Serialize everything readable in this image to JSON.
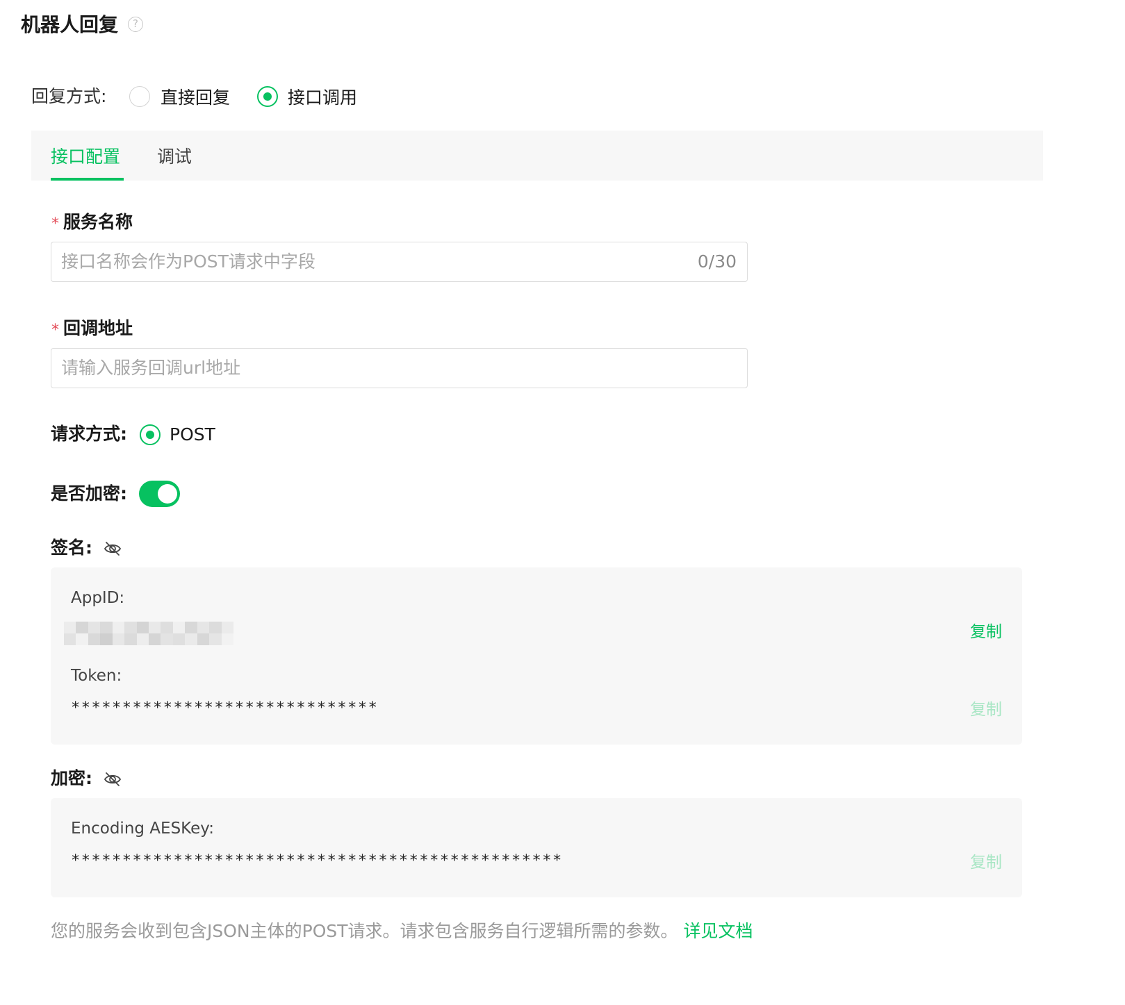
{
  "header": {
    "title": "机器人回复",
    "help_glyph": "?"
  },
  "reply_mode": {
    "label": "回复方式:",
    "options": [
      {
        "label": "直接回复",
        "checked": false
      },
      {
        "label": "接口调用",
        "checked": true
      }
    ]
  },
  "tabs": [
    {
      "label": "接口配置",
      "active": true
    },
    {
      "label": "调试",
      "active": false
    }
  ],
  "form": {
    "service_name": {
      "required_mark": "*",
      "label": "服务名称",
      "placeholder": "接口名称会作为POST请求中字段",
      "counter": "0/30"
    },
    "callback_url": {
      "required_mark": "*",
      "label": "回调地址",
      "placeholder": "请输入服务回调url地址"
    },
    "request_method": {
      "label": "请求方式:",
      "option": "POST",
      "checked": true
    },
    "encryption_toggle": {
      "label": "是否加密:",
      "on": true
    }
  },
  "signature": {
    "label": "签名:",
    "appid_label": "AppID:",
    "appid_copy": "复制",
    "token_label": "Token:",
    "token_value": "******************************",
    "token_copy": "复制"
  },
  "encryption": {
    "label": "加密:",
    "aes_label": "Encoding AESKey:",
    "aes_value": "************************************************",
    "aes_copy": "复制"
  },
  "footnote": {
    "text": "您的服务会收到包含JSON主体的POST请求。请求包含服务自行逻辑所需的参数。 ",
    "link": "详见文档"
  },
  "colors": {
    "accent": "#07c160",
    "required": "#e34d59",
    "panel_bg": "#f7f7f7"
  },
  "icons": {
    "help": "question-circle-icon",
    "signature_visibility": "eye-off-icon",
    "encryption_visibility": "eye-off-icon"
  }
}
